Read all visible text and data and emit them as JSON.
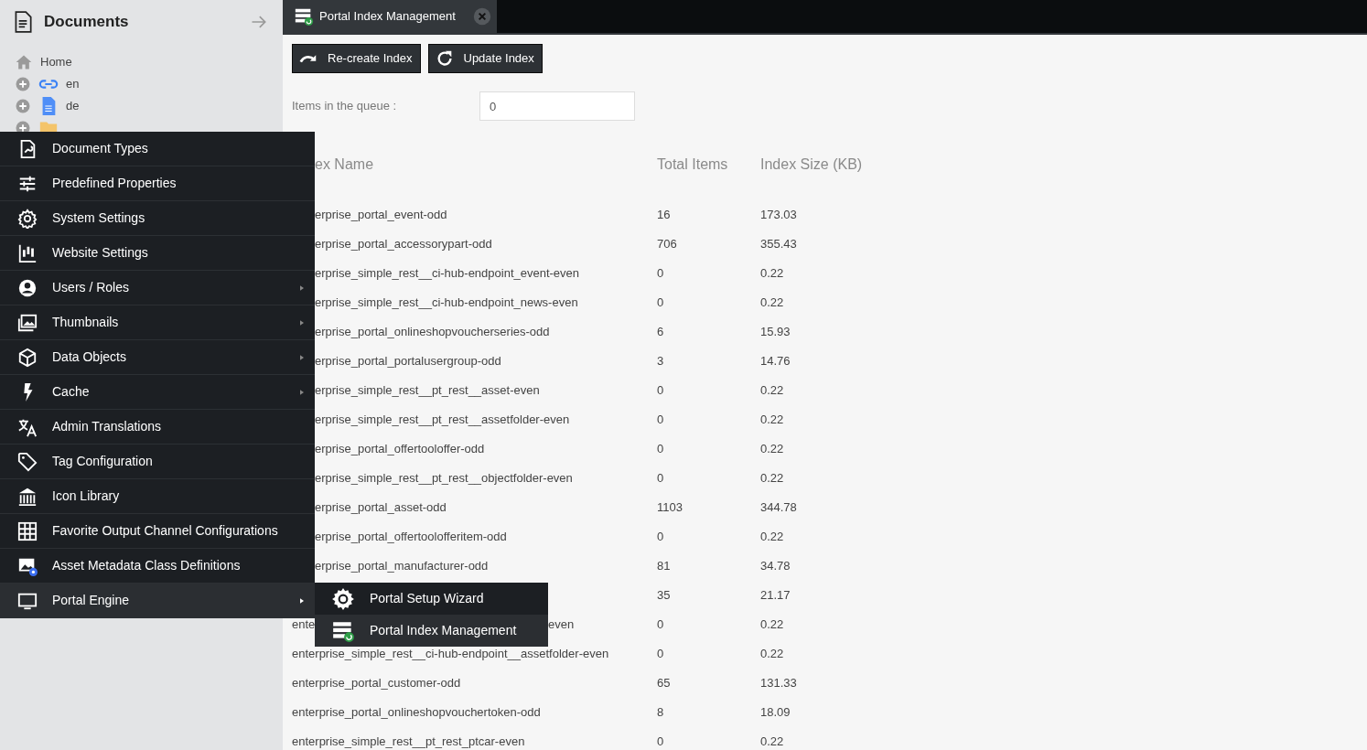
{
  "sidebar": {
    "title": "Documents",
    "tree": [
      {
        "label": "Home",
        "kind": "home"
      },
      {
        "label": "en",
        "kind": "link"
      },
      {
        "label": "de",
        "kind": "page"
      },
      {
        "kind": "folder"
      }
    ]
  },
  "tab": {
    "label": "Portal Index Management",
    "selected": true
  },
  "buttons": [
    "Re-create Index",
    "Update Index"
  ],
  "queue": {
    "label": "Items in the queue :",
    "value": "0"
  },
  "table": {
    "columns": [
      {
        "label": "ex Name",
        "kind": "clipped"
      },
      {
        "label": "Total Items",
        "kind": "plain"
      },
      {
        "label": "Index Size (KB)",
        "kind": "plain"
      }
    ],
    "rows": [
      {
        "name": "erprise_portal_event-odd",
        "kind": "clipped",
        "total": "16",
        "size": "173.03"
      },
      {
        "name": "erprise_portal_accessorypart-odd",
        "kind": "clipped",
        "total": "706",
        "size": "355.43"
      },
      {
        "name": "erprise_simple_rest__ci-hub-endpoint_event-even",
        "kind": "clipped",
        "total": "0",
        "size": "0.22"
      },
      {
        "name": "erprise_simple_rest__ci-hub-endpoint_news-even",
        "kind": "clipped",
        "total": "0",
        "size": "0.22"
      },
      {
        "name": "erprise_portal_onlineshopvoucherseries-odd",
        "kind": "clipped",
        "total": "6",
        "size": "15.93"
      },
      {
        "name": "erprise_portal_portalusergroup-odd",
        "kind": "clipped",
        "total": "3",
        "size": "14.76"
      },
      {
        "name": "erprise_simple_rest__pt_rest__asset-even",
        "kind": "clipped",
        "total": "0",
        "size": "0.22"
      },
      {
        "name": "erprise_simple_rest__pt_rest__assetfolder-even",
        "kind": "clipped",
        "total": "0",
        "size": "0.22"
      },
      {
        "name": "erprise_portal_offertooloffer-odd",
        "kind": "clipped",
        "total": "0",
        "size": "0.22"
      },
      {
        "name": "erprise_simple_rest__pt_rest__objectfolder-even",
        "kind": "clipped",
        "total": "0",
        "size": "0.22"
      },
      {
        "name": "erprise_portal_asset-odd",
        "kind": "clipped",
        "total": "1103",
        "size": "344.78"
      },
      {
        "name": "erprise_portal_offertoolofferitem-odd",
        "kind": "clipped",
        "total": "0",
        "size": "0.22"
      },
      {
        "name": "erprise_portal_manufacturer-odd",
        "kind": "clipped",
        "total": "81",
        "size": "34.78"
      },
      {
        "kind": "hidden",
        "total": "35",
        "size": "21.17"
      },
      {
        "name": "ente",
        "tail": "even",
        "kind": "split",
        "total": "0",
        "size": "0.22"
      },
      {
        "name": "enterprise_simple_rest__ci-hub-endpoint__assetfolder-even",
        "kind": "plain",
        "total": "0",
        "size": "0.22"
      },
      {
        "name": "enterprise_portal_customer-odd",
        "kind": "plain",
        "total": "65",
        "size": "131.33"
      },
      {
        "name": "enterprise_portal_onlineshopvouchertoken-odd",
        "kind": "plain",
        "total": "8",
        "size": "18.09"
      },
      {
        "name": "enterprise_simple_rest__pt_rest_ptcar-even",
        "kind": "plain",
        "total": "0",
        "size": "0.22"
      }
    ]
  },
  "menu": [
    {
      "label": "Document Types",
      "submenu": false,
      "selected": false
    },
    {
      "label": "Predefined Properties",
      "submenu": false,
      "selected": false
    },
    {
      "label": "System Settings",
      "submenu": false,
      "selected": false
    },
    {
      "label": "Website Settings",
      "submenu": false,
      "selected": false
    },
    {
      "label": "Users / Roles",
      "submenu": true,
      "selected": false
    },
    {
      "label": "Thumbnails",
      "submenu": true,
      "selected": false
    },
    {
      "label": "Data Objects",
      "submenu": true,
      "selected": false
    },
    {
      "label": "Cache",
      "submenu": true,
      "selected": false
    },
    {
      "label": "Admin Translations",
      "submenu": false,
      "selected": false
    },
    {
      "label": "Tag Configuration",
      "submenu": false,
      "selected": false
    },
    {
      "label": "Icon Library",
      "submenu": false,
      "selected": false
    },
    {
      "label": "Favorite Output Channel Configurations",
      "submenu": false,
      "selected": false
    },
    {
      "label": "Asset Metadata Class Definitions",
      "submenu": false,
      "selected": false
    },
    {
      "label": "Portal Engine",
      "submenu": true,
      "selected": true
    }
  ],
  "submenu": [
    {
      "label": "Portal Setup Wizard",
      "selected": false
    },
    {
      "label": "Portal Index Management",
      "selected": true
    }
  ]
}
